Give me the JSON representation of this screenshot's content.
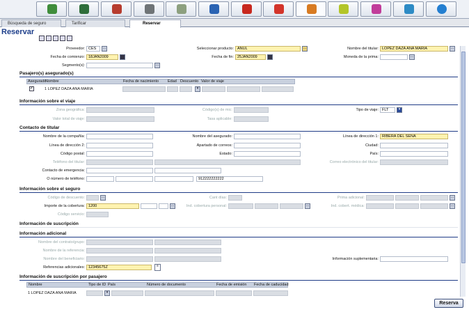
{
  "tabs": [
    {
      "label": "Búsqueda de seguro"
    },
    {
      "label": "Tarificar"
    },
    {
      "label": "Reservar"
    }
  ],
  "page": {
    "title": "Reservar"
  },
  "top": {
    "proveedor_label": "Proveedor:",
    "proveedor": "CES",
    "producto_label": "Seleccionar producto:",
    "producto": "ANUL",
    "titular_label": "Nombre del titular:",
    "titular": "LOPEZ DAZA ANA MARIA",
    "fecha_comienzo_label": "Fecha de comienzo:",
    "fecha_comienzo": "18JAN2009",
    "fecha_fin_label": "Fecha de fin:",
    "fecha_fin": "25JAN2009",
    "moneda_label": "Moneda de la prima:",
    "segmentos_label": "Segmento(s):"
  },
  "pasajeros": {
    "section": "Pasajero(s) asegurado(s)",
    "headers": [
      "Asegurado",
      "Nombre",
      "Fecha de nacimiento",
      "Edad",
      "Descuento",
      "Valor de viaje"
    ],
    "row": {
      "checked": "✓",
      "nombre": "1 LOPEZ DAZA ANA MARIA"
    }
  },
  "viaje": {
    "section": "Información sobre el viaje",
    "zona": "Zona geográfica:",
    "codigo_mic": "Código(s) de mic:",
    "valor_total": "Valor total de viaje:",
    "tasa": "Tasa aplicable:",
    "tipo_label": "Tipo de viaje:",
    "tipo": "FLT"
  },
  "contacto": {
    "section": "Contacto de titular",
    "compania": "Nombre de la compañía:",
    "asegurado": "Nombre del asegurado:",
    "dir1_label": "Línea de dirección 1:",
    "dir1": "RIBERA DEL SENA",
    "dir2": "Línea de dirección 2:",
    "apartado": "Apartado de correos:",
    "ciudad": "Ciudad:",
    "postal": "Código postal:",
    "estado": "Estado:",
    "pais": "País:",
    "telefono_titular": "Teléfono del titular:",
    "correo": "Correo electrónico del titular:",
    "emergencia": "Contacto de emergencia:",
    "telefono": "O número de teléfono:",
    "telefono_valor": "912222222222"
  },
  "seguro": {
    "section": "Información sobre el seguro",
    "descuento": "Código de descuento:",
    "cant": "Cant días:",
    "prima": "Prima adicional:",
    "importe_label": "Importe de la cobertura:",
    "importe": "1200",
    "ind_personal": "Ind. cobertura personal:",
    "ind_medica": "Ind. cobert. médica:",
    "servicio": "Código servicio:"
  },
  "suscripcion": {
    "section": "Información de suscripción"
  },
  "adicional": {
    "section": "Información adicional",
    "contrato": "Nombre del contrato/grupo:",
    "referencia": "Nombre de la referencia:",
    "beneficiario": "Nombre del beneficiario:",
    "suplementaria": "Información suplementaria:",
    "referencias_label": "Referencias adicionales:",
    "referencias": "12345675Z"
  },
  "susc_pasajero": {
    "section": "Información de suscripción por pasajero",
    "headers": [
      "Nombre",
      "Tipo de ID",
      "País",
      "Número de documento",
      "Fecha de emisión",
      "Fecha de caducidad"
    ],
    "row": "1 LOPEZ DAZA ANA MARIA"
  },
  "actions": {
    "reserva": "Reserva"
  },
  "icons": [
    "earth-icon",
    "map-icon",
    "person-icon",
    "clock-icon",
    "tree-icon",
    "car-icon",
    "flag-icon",
    "flag-icon",
    "umbrella-icon",
    "leaf-icon",
    "tag-icon",
    "phone-icon",
    "info-icon"
  ]
}
